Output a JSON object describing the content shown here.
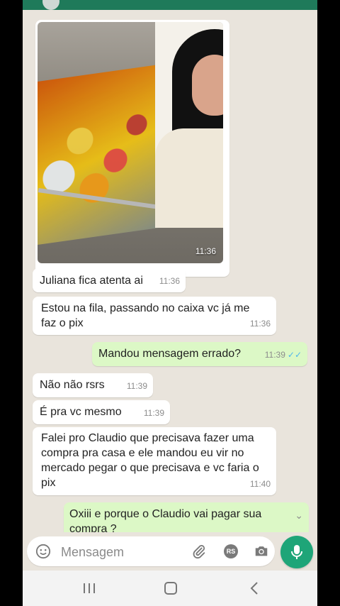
{
  "messages": [
    {
      "dir": "in",
      "text": "Juliana fica atenta ai",
      "time": "11:36"
    },
    {
      "dir": "in",
      "text": "Estou na fila, passando no caixa vc já me faz o pix",
      "time": "11:36"
    },
    {
      "dir": "out",
      "text": "Mandou mensagem errado?",
      "time": "11:39"
    },
    {
      "dir": "in",
      "text": "Não não rsrs",
      "time": "11:39"
    },
    {
      "dir": "in",
      "text": "É pra vc mesmo",
      "time": "11:39"
    },
    {
      "dir": "in",
      "text": "Falei pro Claudio que precisava fazer uma compra pra casa e ele mandou eu vir no mercado pegar o que precisava e vc faria o pix",
      "time": "11:40"
    },
    {
      "dir": "out",
      "text": "Oxiii e porque o Claudio vai pagar sua compra ?",
      "time": ""
    }
  ],
  "image_message": {
    "time": "11:36"
  },
  "input": {
    "placeholder": "Mensagem",
    "rs_label": "RS"
  },
  "colors": {
    "header": "#1f7a5a",
    "outgoing": "#dcf8c6",
    "mic": "#1ea578",
    "read_ticks": "#4fb6ec"
  },
  "icons": [
    "emoji-icon",
    "attach-clip-icon",
    "rs-icon",
    "camera-icon",
    "mic-icon",
    "recents-icon",
    "home-icon",
    "back-icon",
    "scroll-down-chevron-icon"
  ]
}
